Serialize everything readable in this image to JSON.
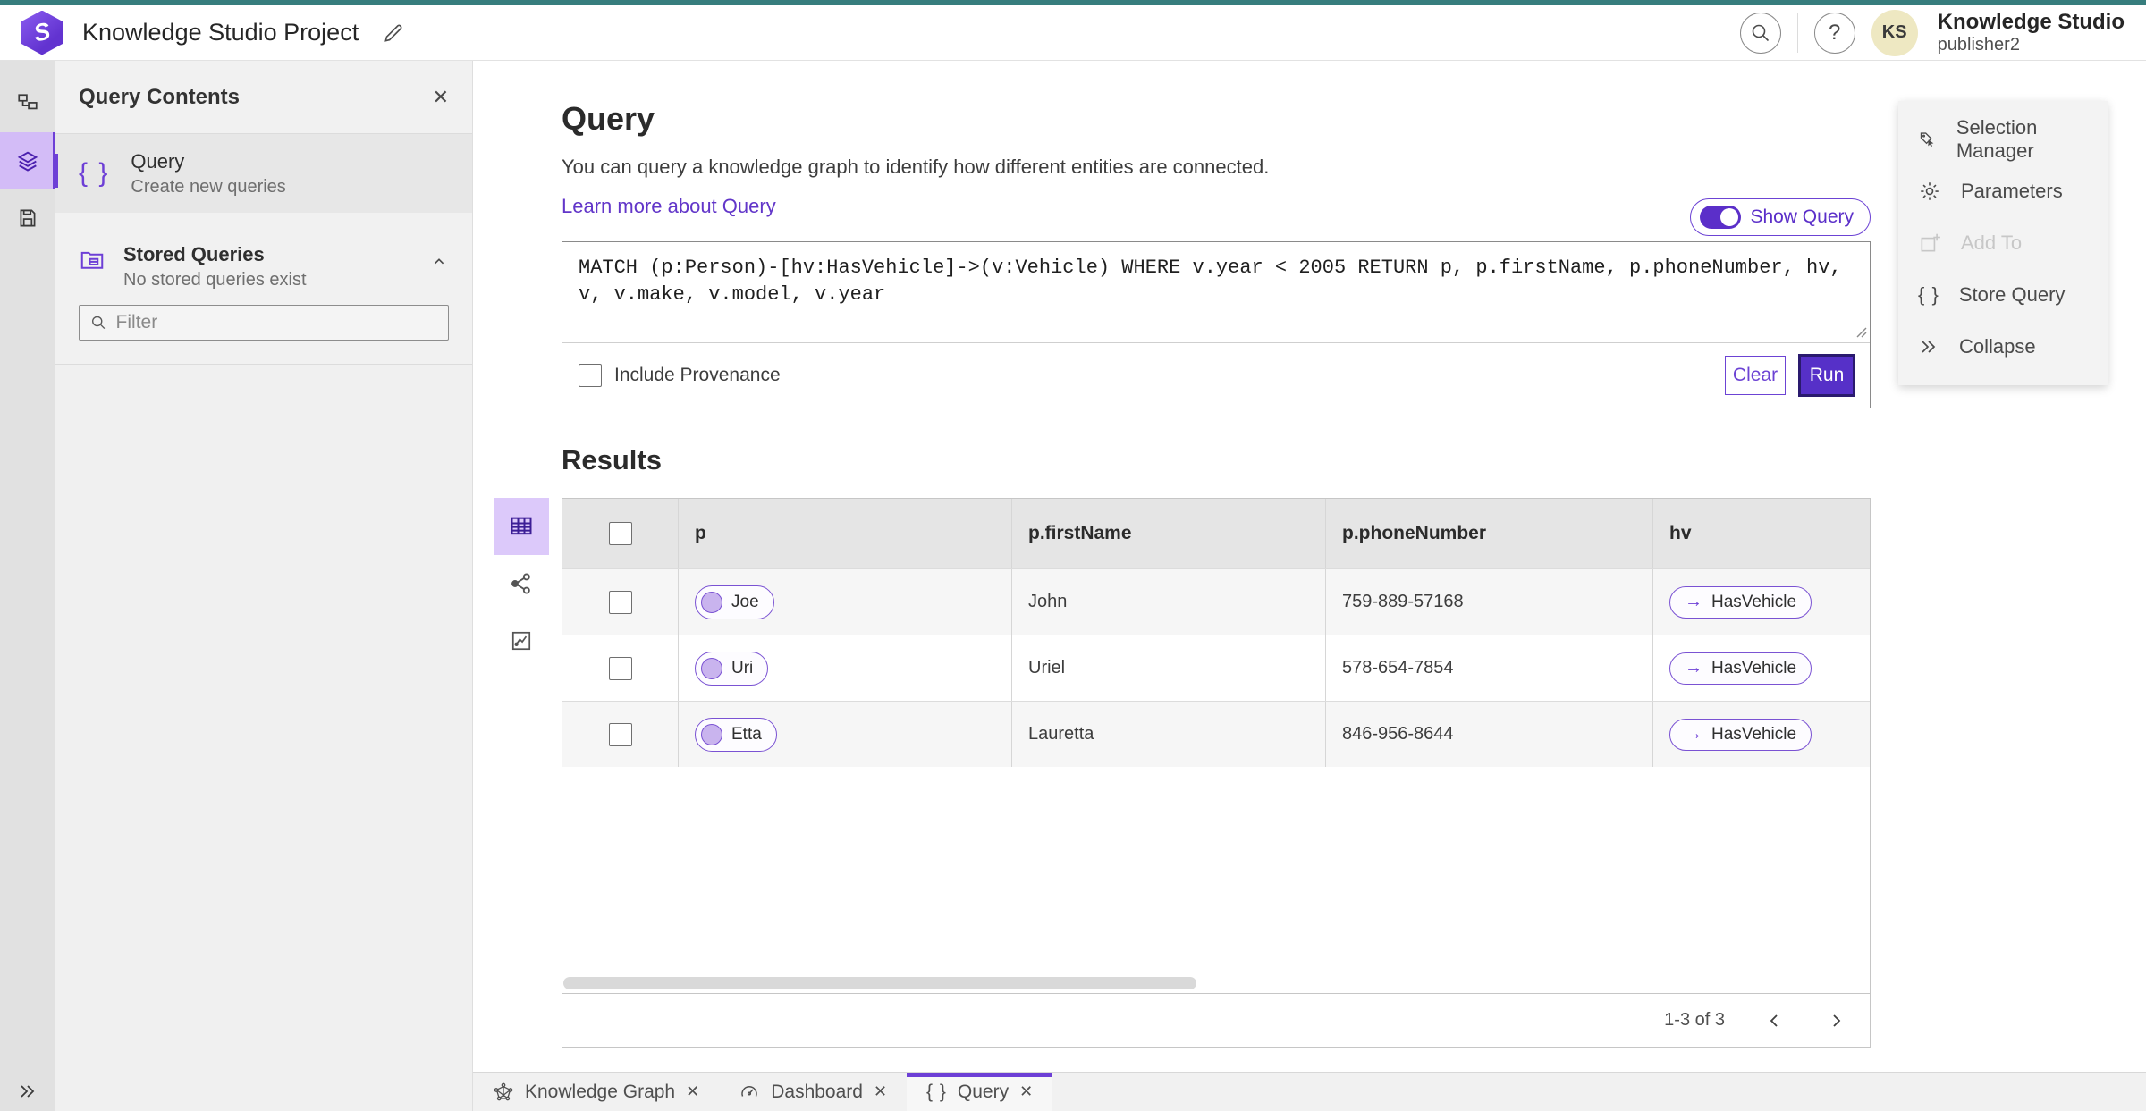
{
  "colors": {
    "accent": "#5b2fc9",
    "accent_light": "#d3bcf7",
    "teal_bar": "#377d7d",
    "run_button": "#5630c8"
  },
  "topbar": {
    "title": "Knowledge Studio Project",
    "user_initials": "KS",
    "user_name": "Knowledge Studio",
    "user_role": "publisher2",
    "help_glyph": "?"
  },
  "icons": {
    "close": "✕",
    "braces": "{ }",
    "edge_arrow": "→"
  },
  "side_panel": {
    "title": "Query Contents",
    "query_item": {
      "title": "Query",
      "subtitle": "Create new queries"
    },
    "stored": {
      "title": "Stored Queries",
      "subtitle": "No stored queries exist"
    },
    "filter_placeholder": "Filter"
  },
  "query_section": {
    "heading": "Query",
    "description": "You can query a knowledge graph to identify how different entities are connected.",
    "learn_more": "Learn more about Query",
    "show_query_label": "Show Query",
    "query_text": "MATCH (p:Person)-[hv:HasVehicle]->(v:Vehicle) WHERE v.year < 2005 RETURN p, p.firstName, p.phoneNumber, hv, v, v.make, v.model, v.year",
    "include_provenance_label": "Include Provenance",
    "clear_label": "Clear",
    "run_label": "Run"
  },
  "results": {
    "heading": "Results",
    "columns": [
      "p",
      "p.firstName",
      "p.phoneNumber",
      "hv"
    ],
    "rows": [
      {
        "p": "Joe",
        "firstName": "John",
        "phoneNumber": "759-889-57168",
        "hv": "HasVehicle"
      },
      {
        "p": "Uri",
        "firstName": "Uriel",
        "phoneNumber": "578-654-7854",
        "hv": "HasVehicle"
      },
      {
        "p": "Etta",
        "firstName": "Lauretta",
        "phoneNumber": "846-956-8644",
        "hv": "HasVehicle"
      }
    ],
    "pagination": {
      "range": "1-3 of 3"
    }
  },
  "actions_panel": {
    "items": [
      {
        "label": "Selection Manager"
      },
      {
        "label": "Parameters"
      },
      {
        "label": "Add To",
        "disabled": true
      },
      {
        "label": "Store Query"
      },
      {
        "label": "Collapse"
      }
    ]
  },
  "tabs": [
    {
      "label": "Knowledge Graph"
    },
    {
      "label": "Dashboard"
    },
    {
      "label": "Query",
      "active": true
    }
  ]
}
